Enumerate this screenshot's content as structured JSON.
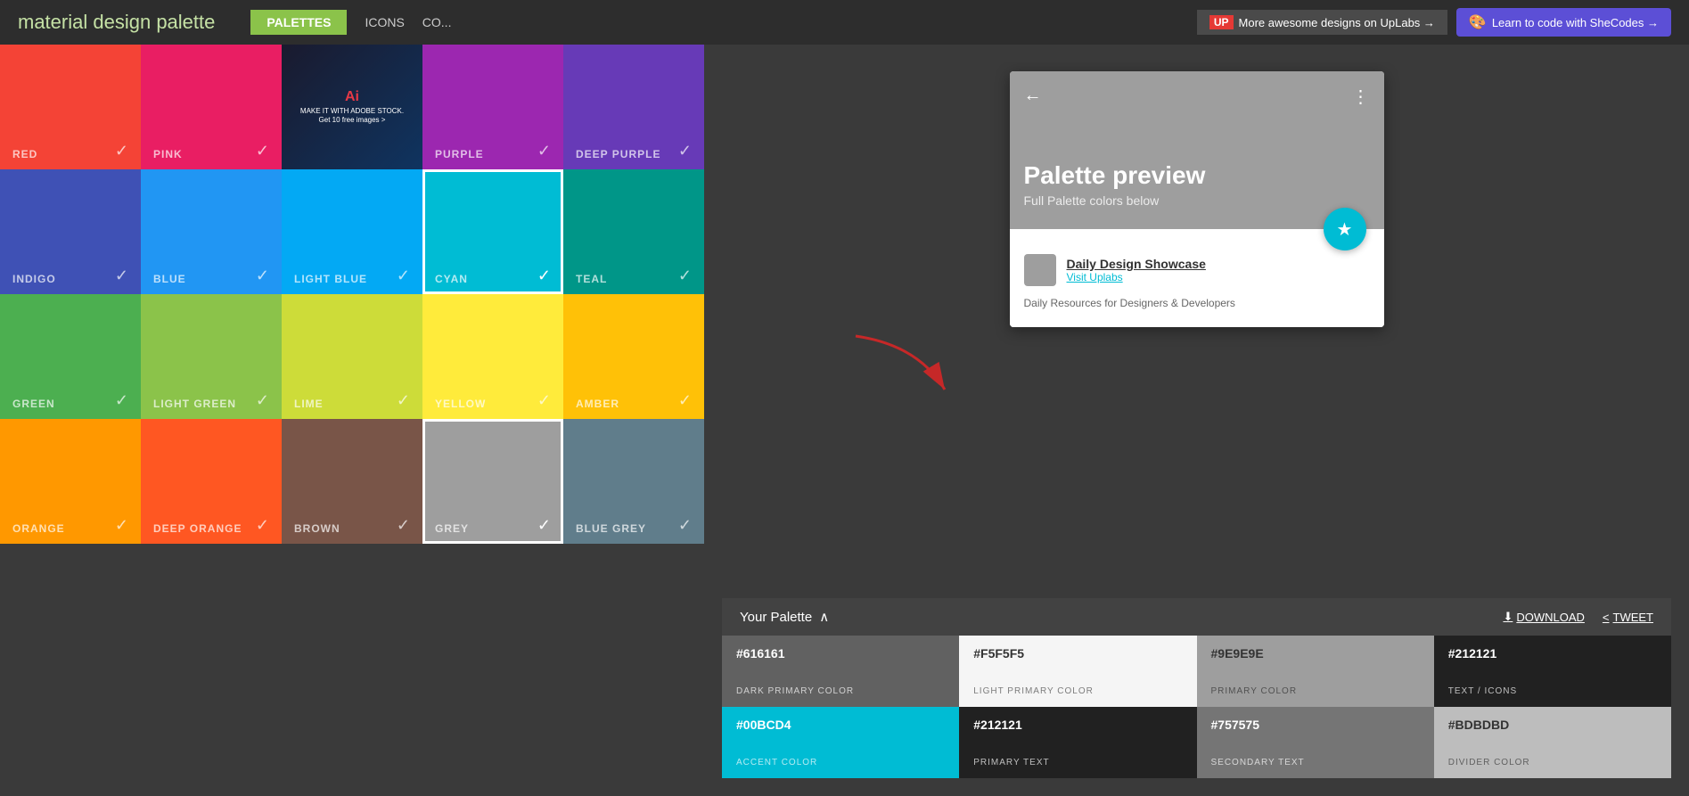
{
  "header": {
    "logo_text": "material design ",
    "logo_highlight": "palette",
    "nav": {
      "palettes_label": "PALETTES",
      "icons_label": "ICONS",
      "colors_label": "CO..."
    },
    "uplabs_banner": "More awesome designs on UpLabs →",
    "shecodes_banner": "Learn to code with SheCodes →"
  },
  "colors": [
    {
      "id": "red",
      "label": "RED",
      "bg": "#f44336",
      "checked": true
    },
    {
      "id": "pink",
      "label": "PINK",
      "bg": "#e91e63",
      "checked": true
    },
    {
      "id": "ad",
      "label": "",
      "bg": "#000",
      "ad": true
    },
    {
      "id": "purple",
      "label": "PURPLE",
      "bg": "#9c27b0",
      "checked": true
    },
    {
      "id": "deep-purple",
      "label": "DEEP PURPLE",
      "bg": "#673ab7",
      "checked": true
    },
    {
      "id": "indigo",
      "label": "INDIGO",
      "bg": "#3f51b5",
      "checked": true
    },
    {
      "id": "blue",
      "label": "BLUE",
      "bg": "#2196f3",
      "checked": true
    },
    {
      "id": "light-blue",
      "label": "LIGHT BLUE",
      "bg": "#03a9f4",
      "checked": true
    },
    {
      "id": "cyan",
      "label": "CYAN",
      "bg": "#00bcd4",
      "checked": true,
      "selected": true
    },
    {
      "id": "teal",
      "label": "TEAL",
      "bg": "#009688",
      "checked": true
    },
    {
      "id": "green",
      "label": "GREEN",
      "bg": "#4caf50",
      "checked": true
    },
    {
      "id": "light-green",
      "label": "LIGHT GREEN",
      "bg": "#8bc34a",
      "checked": true
    },
    {
      "id": "lime",
      "label": "LIME",
      "bg": "#cddc39",
      "checked": true
    },
    {
      "id": "yellow",
      "label": "YELLOW",
      "bg": "#ffeb3b",
      "checked": true
    },
    {
      "id": "amber",
      "label": "AMBER",
      "bg": "#ffc107",
      "checked": true
    },
    {
      "id": "orange",
      "label": "ORANGE",
      "bg": "#ff9800",
      "checked": true
    },
    {
      "id": "deep-orange",
      "label": "DEEP ORANGE",
      "bg": "#ff5722",
      "checked": true
    },
    {
      "id": "brown",
      "label": "BROWN",
      "bg": "#795548",
      "checked": true
    },
    {
      "id": "grey",
      "label": "GREY",
      "bg": "#9e9e9e",
      "checked": true,
      "selected": true
    },
    {
      "id": "blue-grey",
      "label": "BLUE GREY",
      "bg": "#607d8b",
      "checked": true
    }
  ],
  "preview": {
    "title": "Palette preview",
    "subtitle": "Full Palette colors below",
    "back_icon": "←",
    "more_icon": "⋮",
    "star_icon": "★",
    "list_item_title": "Daily Design Showcase",
    "list_item_link": "Visit Uplabs",
    "list_item_desc": "Daily Resources for Designers & Developers"
  },
  "palette": {
    "header_label": "Your Palette",
    "chevron": "∧",
    "download_label": "DOWNLOAD",
    "tweet_label": "TWEET",
    "colors": [
      {
        "hex": "#616161",
        "name": "DARK PRIMARY COLOR",
        "bg": "#616161",
        "light_text": true
      },
      {
        "hex": "#F5F5F5",
        "name": "LIGHT PRIMARY COLOR",
        "bg": "#f5f5f5",
        "light_text": false
      },
      {
        "hex": "#9E9E9E",
        "name": "PRIMARY COLOR",
        "bg": "#9e9e9e",
        "light_text": false
      },
      {
        "hex": "#212121",
        "name": "TEXT / ICONS",
        "bg": "#212121",
        "light_text": true
      },
      {
        "hex": "#00BCD4",
        "name": "ACCENT COLOR",
        "bg": "#00bcd4",
        "light_text": true
      },
      {
        "hex": "#212121",
        "name": "PRIMARY TEXT",
        "bg": "#212121",
        "light_text": true
      },
      {
        "hex": "#757575",
        "name": "SECONDARY TEXT",
        "bg": "#757575",
        "light_text": true
      },
      {
        "hex": "#BDBDBD",
        "name": "DIVIDER COLOR",
        "bg": "#bdbdbd",
        "light_text": false
      }
    ]
  }
}
